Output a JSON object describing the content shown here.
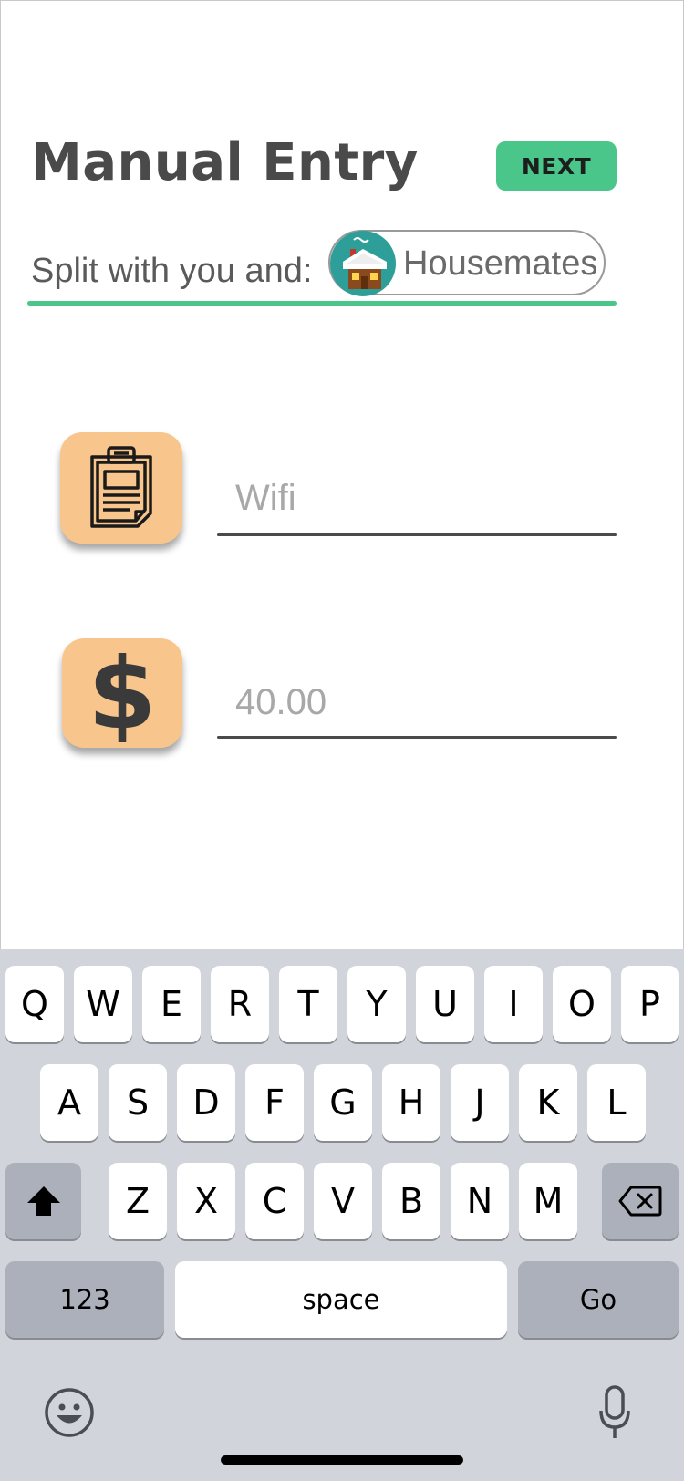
{
  "header": {
    "title": "Manual Entry",
    "next_label": "NEXT"
  },
  "split": {
    "label": "Split with you and:",
    "chip_label": "Housemates",
    "chip_icon": "house-icon"
  },
  "fields": {
    "description_placeholder": "Wifi",
    "description_icon": "clipboard-icon",
    "amount_placeholder": "40.00",
    "amount_icon": "dollar-icon",
    "amount_symbol": "$"
  },
  "keyboard": {
    "row1": [
      "Q",
      "W",
      "E",
      "R",
      "T",
      "Y",
      "U",
      "I",
      "O",
      "P"
    ],
    "row2": [
      "A",
      "S",
      "D",
      "F",
      "G",
      "H",
      "J",
      "K",
      "L"
    ],
    "row3": [
      "Z",
      "X",
      "C",
      "V",
      "B",
      "N",
      "M"
    ],
    "numbers_label": "123",
    "space_label": "space",
    "go_label": "Go",
    "shift_icon": "shift-icon",
    "delete_icon": "backspace-icon",
    "emoji_icon": "emoji-icon",
    "mic_icon": "microphone-icon"
  },
  "colors": {
    "accent_green": "#4ac68a",
    "tile_orange": "#f8c68c",
    "avatar_teal": "#2e9e98",
    "keyboard_bg": "#d1d4db"
  }
}
